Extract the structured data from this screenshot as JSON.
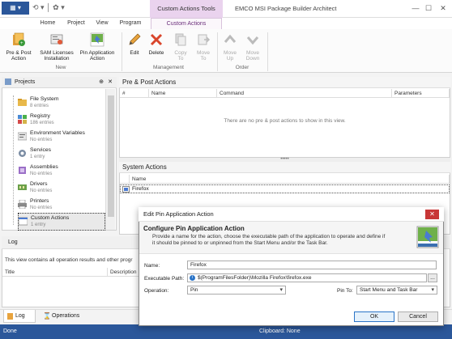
{
  "window": {
    "app_menu_label": "",
    "context_tools_label": "Custom Actions Tools",
    "title": "EMCO MSI Package Builder Architect",
    "minimize": "—",
    "maximize": "☐",
    "close": "✕"
  },
  "tabs": [
    {
      "label": "Home"
    },
    {
      "label": "Project"
    },
    {
      "label": "View"
    },
    {
      "label": "Program"
    },
    {
      "label": "Custom Actions"
    }
  ],
  "ribbon": {
    "new_group": "New",
    "management_group": "Management",
    "order_group": "Order",
    "buttons": {
      "pre_post": "Pre & Post\nAction",
      "sam": "SAM Licenses\nInstallation",
      "pin": "Pin Application\nAction",
      "edit": "Edit",
      "delete": "Delete",
      "copy_to": "Copy\nTo",
      "move_to": "Move\nTo",
      "move_up": "Move\nUp",
      "move_down": "Move\nDown"
    }
  },
  "projects": {
    "title": "Projects",
    "items": [
      {
        "name": "File System",
        "count": "8 entries"
      },
      {
        "name": "Registry",
        "count": "186 entries"
      },
      {
        "name": "Environment Variables",
        "count": "No entries"
      },
      {
        "name": "Services",
        "count": "1 entry"
      },
      {
        "name": "Assemblies",
        "count": "No entries"
      },
      {
        "name": "Drivers",
        "count": "No entries"
      },
      {
        "name": "Printers",
        "count": "No entries"
      },
      {
        "name": "Custom Actions",
        "count": "1 entry"
      }
    ]
  },
  "pre_post": {
    "title": "Pre & Post Actions",
    "columns": [
      "#",
      "Name",
      "Command",
      "Parameters"
    ],
    "empty": "There are no pre & post actions to show in this view."
  },
  "system_actions": {
    "title": "System Actions",
    "column": "Name",
    "rows": [
      "Firefox"
    ]
  },
  "log": {
    "title": "Log",
    "description": "This view contains all operation results and other progr",
    "columns": [
      "Title",
      "Description"
    ],
    "tabs": [
      "Log",
      "Operations"
    ]
  },
  "status": {
    "text": "Done",
    "clipboard": "Clipboard: None"
  },
  "dialog": {
    "title": "Edit Pin Application Action",
    "heading": "Configure Pin Application Action",
    "description": "Provide a name for the action, choose the executable path of the application to operate and define if it should be pinned to or unpinned from the Start Menu and/or the Task Bar.",
    "name_label": "Name:",
    "name_value": "Firefox",
    "exe_label": "Executable Path:",
    "exe_value": "$(ProgramFilesFolder)\\Mozilla Firefox\\firefox.exe",
    "op_label": "Operation:",
    "op_value": "Pin",
    "pinto_label": "Pin To:",
    "pinto_value": "Start Menu and Task Bar",
    "ok": "OK",
    "cancel": "Cancel",
    "browse": "..."
  }
}
